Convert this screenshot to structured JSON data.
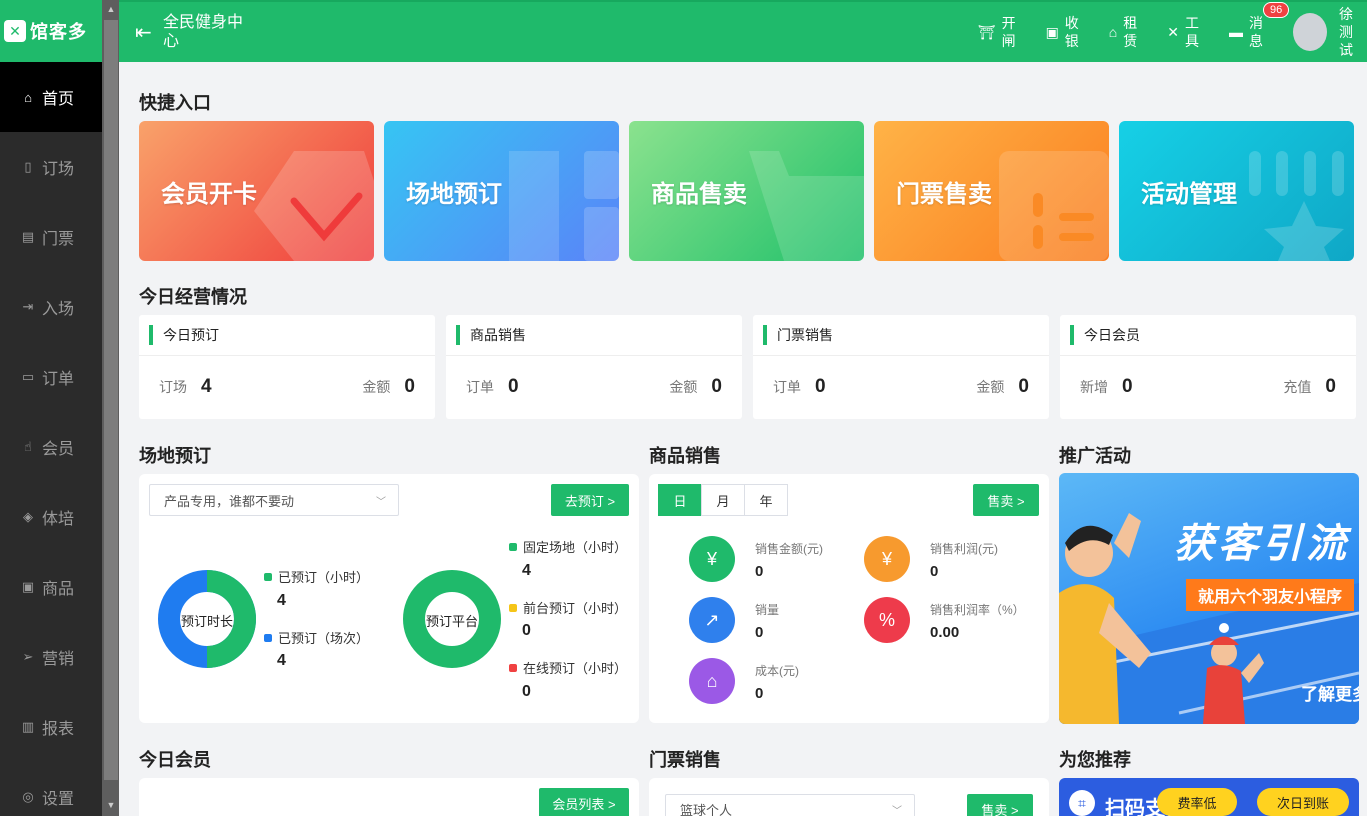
{
  "brand": {
    "logo_text": "馆客多",
    "color": "#1fba6b"
  },
  "sidebar": {
    "items": [
      {
        "label": "首页",
        "icon": "home-icon",
        "active": true
      },
      {
        "label": "订场",
        "icon": "venue-booking-icon"
      },
      {
        "label": "门票",
        "icon": "ticket-icon"
      },
      {
        "label": "入场",
        "icon": "entry-icon"
      },
      {
        "label": "订单",
        "icon": "order-icon"
      },
      {
        "label": "会员",
        "icon": "member-icon"
      },
      {
        "label": "体培",
        "icon": "training-icon"
      },
      {
        "label": "商品",
        "icon": "goods-icon"
      },
      {
        "label": "营销",
        "icon": "marketing-icon"
      },
      {
        "label": "报表",
        "icon": "report-icon"
      },
      {
        "label": "设置",
        "icon": "settings-icon"
      }
    ]
  },
  "header": {
    "venue_name": "全民健身中心",
    "tools": [
      {
        "label": "开闸",
        "icon": "gate-icon"
      },
      {
        "label": "收银",
        "icon": "cashier-icon"
      },
      {
        "label": "租赁",
        "icon": "rental-icon"
      },
      {
        "label": "工具",
        "icon": "tools-icon"
      },
      {
        "label": "消息",
        "icon": "message-icon",
        "badge": "96"
      }
    ],
    "user_name": "徐测试"
  },
  "quick_entry": {
    "title": "快捷入口",
    "items": [
      "会员开卡",
      "场地预订",
      "商品售卖",
      "门票售卖",
      "活动管理"
    ]
  },
  "today_ops": {
    "title": "今日经营情况",
    "cards": [
      {
        "title": "今日预订",
        "left_label": "订场",
        "left_value": "4",
        "right_label": "金额",
        "right_value": "0"
      },
      {
        "title": "商品销售",
        "left_label": "订单",
        "left_value": "0",
        "right_label": "金额",
        "right_value": "0"
      },
      {
        "title": "门票销售",
        "left_label": "订单",
        "left_value": "0",
        "right_label": "金额",
        "right_value": "0"
      },
      {
        "title": "今日会员",
        "left_label": "新增",
        "left_value": "0",
        "right_label": "充值",
        "right_value": "0"
      }
    ]
  },
  "venue_booking": {
    "title": "场地预订",
    "select_value": "产品专用，谁都不要动",
    "button": "去预订 >",
    "donut1": {
      "center": "预订时长",
      "legend": [
        {
          "label": "已预订（小时）",
          "value": "4",
          "color": "#1fba6b"
        },
        {
          "label": "已预订（场次）",
          "value": "4",
          "color": "#1f7cf0"
        }
      ]
    },
    "donut2": {
      "center": "预订平台",
      "legend": [
        {
          "label": "固定场地（小时）",
          "value": "4",
          "color": "#1fba6b"
        },
        {
          "label": "前台预订（小时）",
          "value": "0",
          "color": "#f5c518"
        },
        {
          "label": "在线预订（小时）",
          "value": "0",
          "color": "#f04141"
        }
      ]
    }
  },
  "goods_sales": {
    "title": "商品销售",
    "tabs": [
      "日",
      "月",
      "年"
    ],
    "button": "售卖 >",
    "metrics": [
      {
        "label": "销售金额(元)",
        "value": "0",
        "icon": "yuan-icon",
        "color": "#1fba6b"
      },
      {
        "label": "销售利润(元)",
        "value": "0",
        "icon": "money-bag-icon",
        "color": "#f79a2e"
      },
      {
        "label": "销量",
        "value": "0",
        "icon": "line-chart-icon",
        "color": "#2f80ed"
      },
      {
        "label": "销售利润率（%）",
        "value": "0.00",
        "icon": "coins-icon",
        "color": "#ee3b4b"
      },
      {
        "label": "成本(元)",
        "value": "0",
        "icon": "presentation-icon",
        "color": "#9b59e6"
      }
    ]
  },
  "promo": {
    "title": "推广活动",
    "headline": "获客引流",
    "subline": "就用六个羽友小程序",
    "more": "了解更多"
  },
  "today_members": {
    "title": "今日会员",
    "button": "会员列表 >"
  },
  "ticket_sales": {
    "title": "门票销售",
    "select_value": "篮球个人",
    "button": "售卖 >"
  },
  "recommend": {
    "title": "为您推荐",
    "banner": "扫码支付",
    "pill1": "费率低",
    "pill2": "次日到账"
  }
}
